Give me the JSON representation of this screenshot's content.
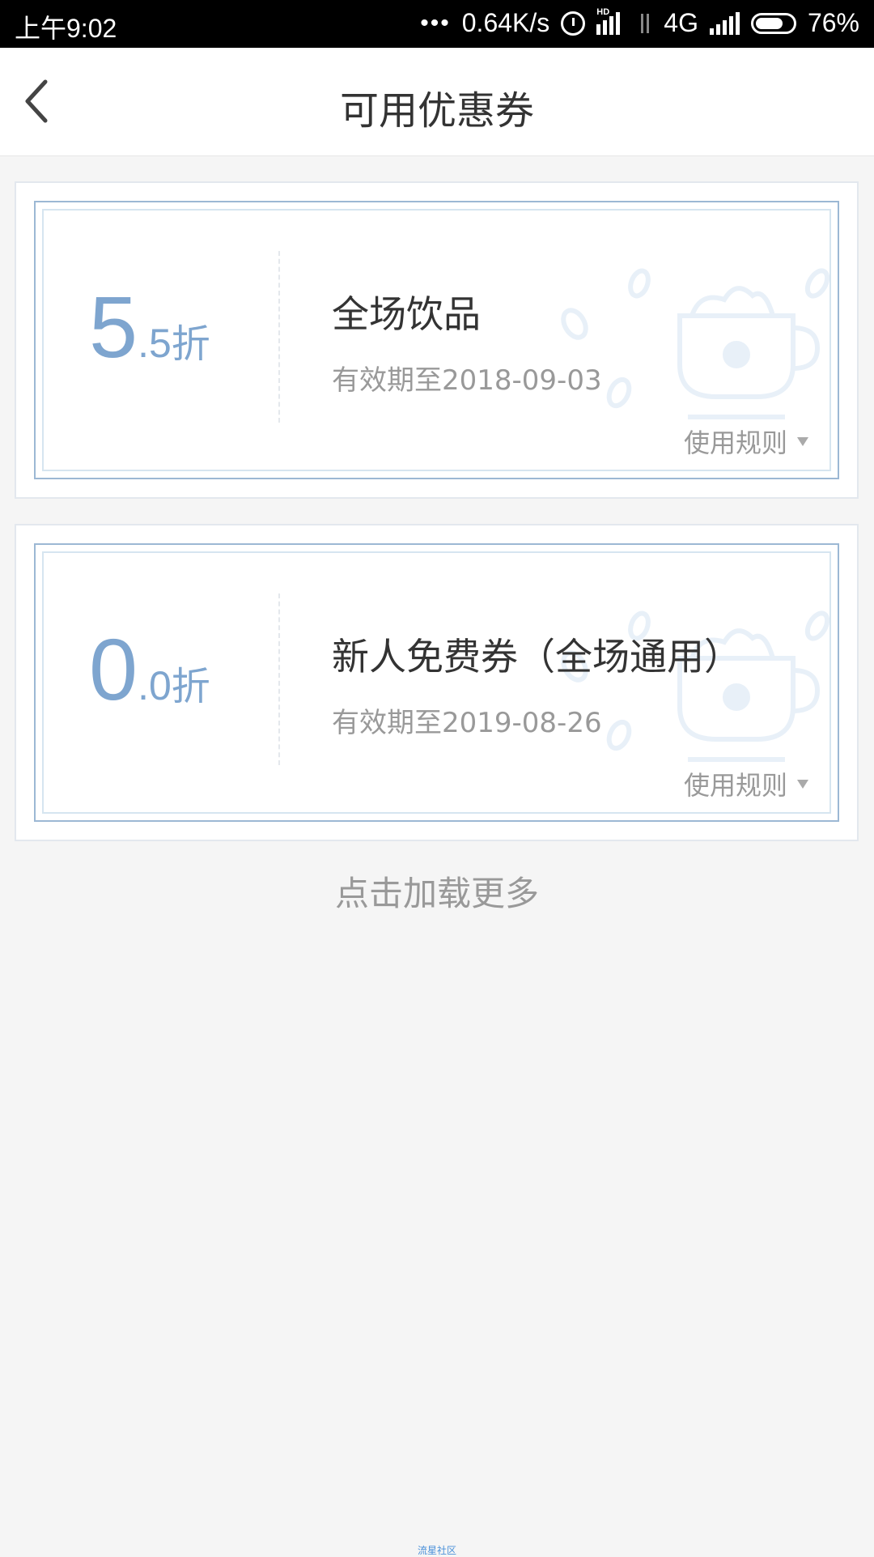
{
  "status_bar": {
    "time": "上午9:02",
    "dots": "•••",
    "speed": "0.64K/s",
    "hd": "HD",
    "network": "4G",
    "battery": "76%",
    "battery_level": 0.76
  },
  "header": {
    "title": "可用优惠券"
  },
  "coupons": [
    {
      "discount_int": "5",
      "discount_dec": ".5",
      "discount_unit": "折",
      "name": "全场饮品",
      "expiry": "有效期至2018-09-03",
      "rules_label": "使用规则"
    },
    {
      "discount_int": "0",
      "discount_dec": ".0",
      "discount_unit": "折",
      "name": "新人免费券（全场通用）",
      "expiry": "有效期至2019-08-26",
      "rules_label": "使用规则"
    }
  ],
  "load_more": "点击加载更多",
  "footer": "流星社区",
  "colors": {
    "accent": "#7ea5cf",
    "border": "#9cb8d4",
    "background": "#f5f5f5"
  }
}
